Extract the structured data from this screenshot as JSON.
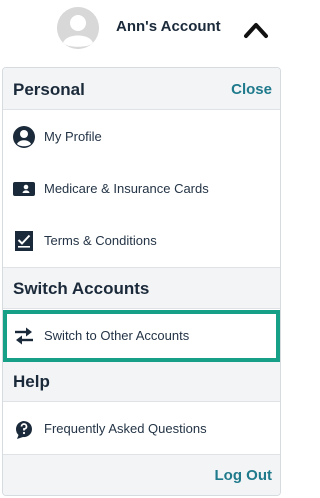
{
  "account": {
    "name": "Ann's Account",
    "avatar_icon": "user-avatar-icon",
    "toggle_icon": "chevron-up-icon"
  },
  "personal": {
    "title": "Personal",
    "close_label": "Close",
    "items": [
      {
        "label": "My Profile",
        "icon": "user-circle-icon"
      },
      {
        "label": "Medicare & Insurance Cards",
        "icon": "id-card-icon"
      },
      {
        "label": "Terms & Conditions",
        "icon": "checklist-icon"
      }
    ]
  },
  "switch_accounts": {
    "title": "Switch Accounts",
    "items": [
      {
        "label": "Switch to Other Accounts",
        "icon": "swap-arrows-icon"
      }
    ]
  },
  "help": {
    "title": "Help",
    "items": [
      {
        "label": "Frequently Asked Questions",
        "icon": "question-bubble-icon"
      }
    ]
  },
  "footer": {
    "logout_label": "Log Out"
  },
  "colors": {
    "accent": "#1f7a8c",
    "highlight": "#17a088",
    "text": "#1b2a3a",
    "section_bg": "#f3f4f6"
  }
}
